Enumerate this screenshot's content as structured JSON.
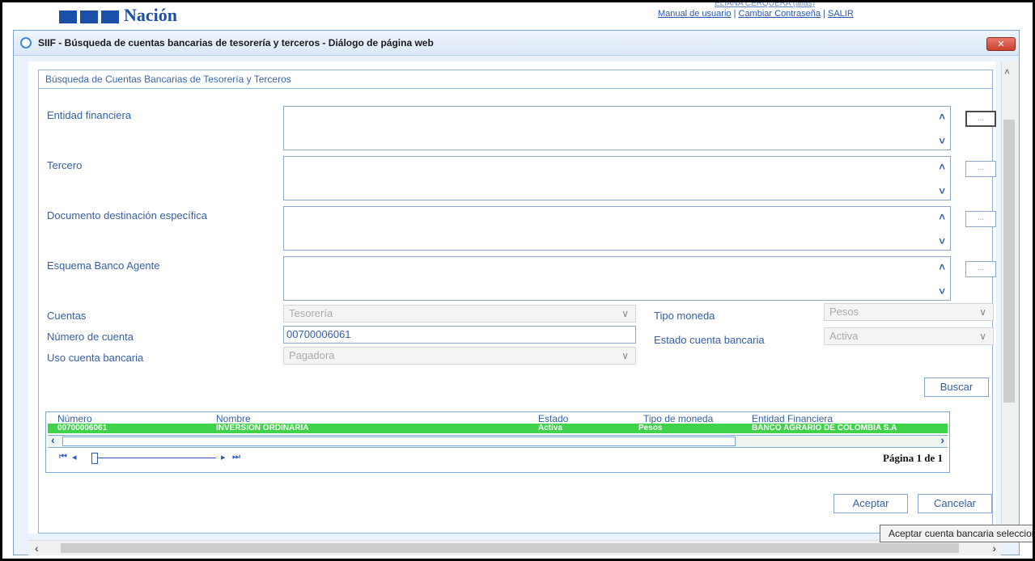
{
  "app": {
    "logo_text": "Nación",
    "links": {
      "truncated_top": "ELIANA CERQUERA (alias)",
      "manual": "Manual de usuario",
      "change_pwd": "Cambiar Contraseña",
      "exit": "SALIR",
      "sep": "|"
    }
  },
  "dialog": {
    "title": "SIIF - Búsqueda de cuentas bancarias de tesorería y terceros - Diálogo de página web",
    "close": "✕"
  },
  "form": {
    "legend": "Búsqueda de Cuentas Bancarias de Tesorería y Terceros",
    "entidad_label": "Entidad financiera",
    "tercero_label": "Tercero",
    "documento_label": "Documento destinación específica",
    "esquema_label": "Esquema Banco Agente",
    "lookup_label": "...",
    "cuentas_label": "Cuentas",
    "cuentas_value": "Tesorería",
    "numero_label": "Número de cuenta",
    "numero_value": "00700006061",
    "uso_label": "Uso cuenta bancaria",
    "uso_value": "Pagadora",
    "tipo_label": "Tipo moneda",
    "tipo_value": "Pesos",
    "estado_label": "Estado cuenta bancaria",
    "estado_value": "Activa",
    "buscar": "Buscar"
  },
  "grid": {
    "headers": {
      "numero": "Número",
      "nombre": "Nombre",
      "estado": "Estado",
      "tipo": "Tipo de moneda",
      "entidad": "Entidad Financiera"
    },
    "row": {
      "numero": "00700006061",
      "nombre": "INVERSION ORDINARIA",
      "estado": "Activa",
      "tipo": "Pesos",
      "entidad": "BANCO AGRARIO DE COLOMBIA S.A"
    },
    "pager": "Página 1 de 1"
  },
  "actions": {
    "aceptar": "Aceptar",
    "cancelar": "Cancelar"
  },
  "tooltip": "Aceptar cuenta bancaria seleccionada"
}
